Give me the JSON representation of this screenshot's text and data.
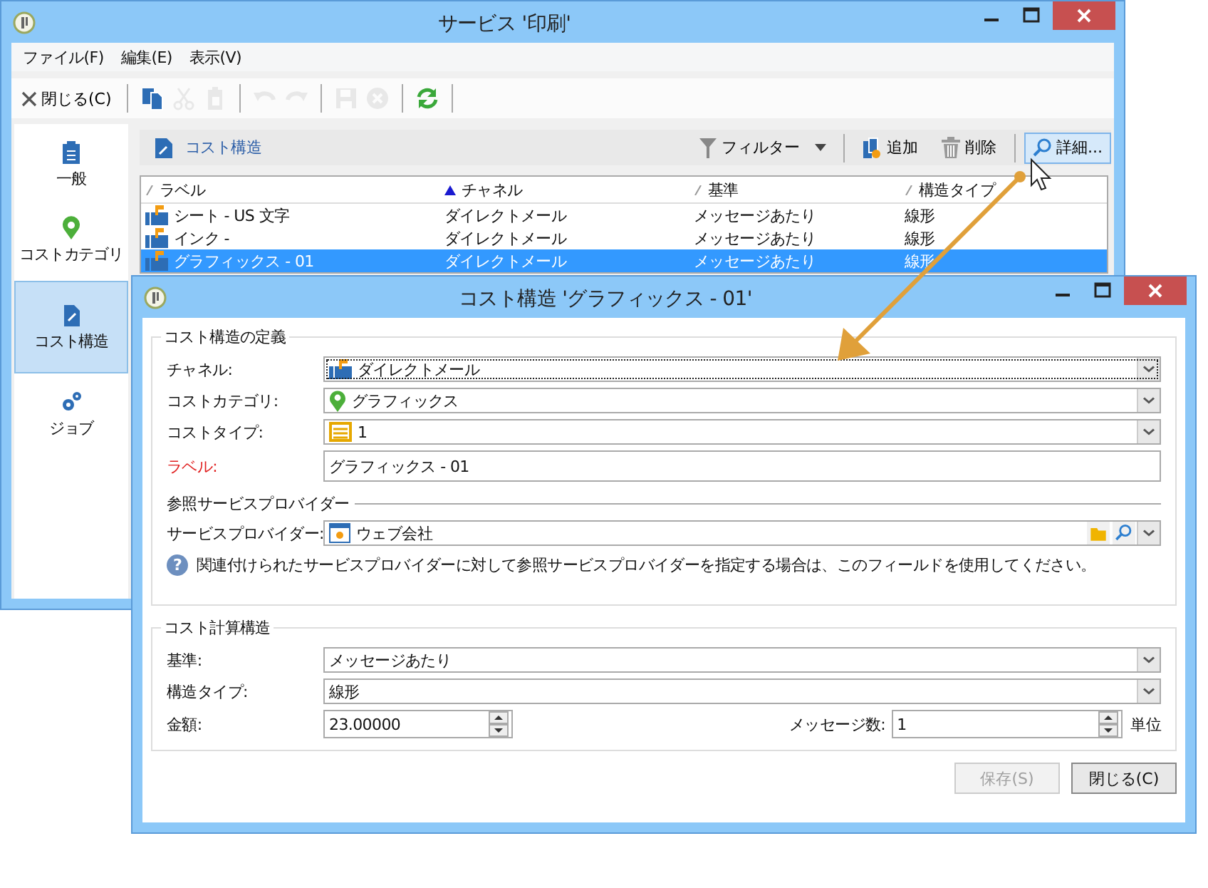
{
  "main_window": {
    "title": "サービス '印刷'",
    "menu": [
      {
        "label": "ファイル(F)"
      },
      {
        "label": "編集(E)"
      },
      {
        "label": "表示(V)"
      }
    ],
    "toolbar": {
      "close_label": "閉じる(C)",
      "groups": [
        {
          "tools": [
            {
              "kind": "copy",
              "disabled": false
            },
            {
              "kind": "cut",
              "disabled": true
            },
            {
              "kind": "paste",
              "disabled": true
            }
          ]
        },
        {
          "tools": [
            {
              "kind": "undo",
              "disabled": true
            },
            {
              "kind": "redo",
              "disabled": true
            }
          ]
        },
        {
          "tools": [
            {
              "kind": "save",
              "disabled": true
            },
            {
              "kind": "cancel",
              "disabled": true
            }
          ]
        },
        {
          "tools": [
            {
              "kind": "refresh",
              "disabled": false
            }
          ]
        }
      ]
    },
    "sidebar": [
      {
        "kind": "general",
        "label": "一般",
        "selected": false
      },
      {
        "kind": "category",
        "label": "コストカテゴリ",
        "selected": false
      },
      {
        "kind": "structure",
        "label": "コスト構造",
        "selected": true
      },
      {
        "kind": "job",
        "label": "ジョブ",
        "selected": false
      }
    ],
    "list_panel": {
      "title": "コスト構造",
      "actions": [
        {
          "kind": "filter",
          "label": "フィルター",
          "hovered": false
        },
        {
          "kind": "add",
          "label": "追加",
          "hovered": false
        },
        {
          "kind": "delete",
          "label": "削除",
          "hovered": false
        },
        {
          "kind": "details",
          "label": "詳細...",
          "hovered": true
        }
      ],
      "columns": [
        {
          "label": "ラベル",
          "sorted": false
        },
        {
          "label": "チャネル",
          "sorted": true
        },
        {
          "label": "基準",
          "sorted": false
        },
        {
          "label": "構造タイプ",
          "sorted": false
        }
      ],
      "rows": [
        {
          "cells": [
            "シート - US 文字",
            "ダイレクトメール",
            "メッセージあたり",
            "線形"
          ],
          "selected": false
        },
        {
          "cells": [
            "インク -",
            "ダイレクトメール",
            "メッセージあたり",
            "線形"
          ],
          "selected": false
        },
        {
          "cells": [
            "グラフィックス - 01",
            "ダイレクトメール",
            "メッセージあたり",
            "線形"
          ],
          "selected": true
        }
      ]
    }
  },
  "dialog": {
    "title": "コスト構造 'グラフィックス - 01'",
    "definition": {
      "legend": "コスト構造の定義",
      "fields": [
        {
          "kind": "combo",
          "label": "チャネル:",
          "value": "ダイレクトメール",
          "required": false,
          "focused": true
        },
        {
          "kind": "combo",
          "label": "コストカテゴリ:",
          "value": "グラフィックス",
          "required": false,
          "focused": false
        },
        {
          "kind": "combo",
          "label": "コストタイプ:",
          "value": "1",
          "required": false,
          "focused": false
        },
        {
          "kind": "text",
          "label": "ラベル:",
          "value": "グラフィックス - 01",
          "required": true,
          "focused": false
        }
      ]
    },
    "reference": {
      "legend": "参照サービスプロバイダー",
      "label": "サービスプロバイダー:",
      "value": "ウェブ会社",
      "help_icon": "?",
      "help": "関連付けられたサービスプロバイダーに対して参照サービスプロバイダーを指定する場合は、このフィールドを使用してください。"
    },
    "calculation": {
      "legend": "コスト計算構造",
      "fields": [
        {
          "kind": "combo",
          "label": "基準:",
          "value": "メッセージあたり"
        },
        {
          "kind": "combo",
          "label": "構造タイプ:",
          "value": "線形"
        }
      ],
      "amount": {
        "label": "金額:",
        "value": "23.00000"
      },
      "count": {
        "label": "メッセージ数:",
        "value": "1"
      },
      "unit": "単位"
    },
    "buttons": [
      {
        "label": "保存(S)",
        "disabled": true
      },
      {
        "label": "閉じる(C)",
        "disabled": false
      }
    ]
  }
}
